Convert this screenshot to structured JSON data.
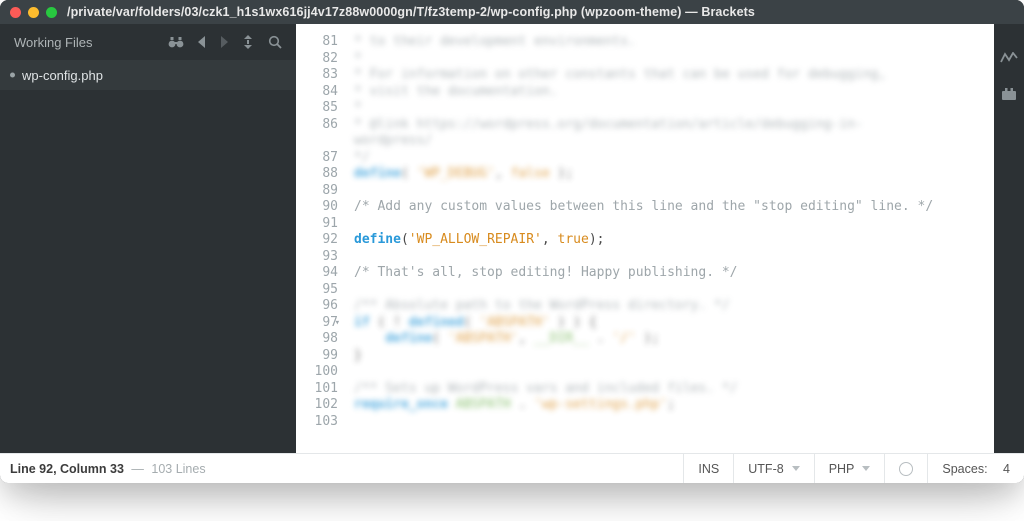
{
  "window": {
    "path": "/private/var/folders/03/czk1_h1s1wx616jj4v17z88w0000gn/T/fz3temp-2/wp-config.php (wpzoom-theme)",
    "appName": "Brackets"
  },
  "sidebar": {
    "workingFilesLabel": "Working Files",
    "files": [
      {
        "name": "wp-config.php"
      }
    ]
  },
  "editor": {
    "firstLine": 81,
    "lastLine": 103,
    "lines": {
      "81": {
        "blurred": true,
        "text": "* to their development environments."
      },
      "82": {
        "blurred": true,
        "text": "*"
      },
      "83": {
        "blurred": true,
        "text": "* For information on other constants that can be used for debugging,"
      },
      "84": {
        "blurred": true,
        "text": "* visit the documentation."
      },
      "85": {
        "blurred": true,
        "text": "*"
      },
      "86": {
        "blurred": true,
        "text": "* @link https://wordpress.org/documentation/article/debugging-in-"
      },
      "86b": {
        "blurred": true,
        "text": "wordpress/"
      },
      "87": {
        "blurred": true,
        "text": " */"
      },
      "88": {
        "blurred": true,
        "html": "<span class='c-kw'>define</span>( <span class='c-str'>'WP_DEBUG'</span>, <span class='c-bool'>false</span> );"
      },
      "89": {
        "blurred": false,
        "html": ""
      },
      "90": {
        "blurred": false,
        "html": "<span class='c-comm'>/* Add any custom values between this line and the &quot;stop editing&quot; line. */</span>"
      },
      "91": {
        "blurred": false,
        "html": ""
      },
      "92": {
        "blurred": false,
        "html": "<span class='c-kw'>define</span>(<span class='c-str'>'WP_ALLOW_REPAIR'</span>, <span class='c-bool'>true</span>);"
      },
      "93": {
        "blurred": false,
        "html": ""
      },
      "94": {
        "blurred": false,
        "html": "<span class='c-comm'>/* That's all, stop editing! Happy publishing. */</span>"
      },
      "95": {
        "blurred": false,
        "html": ""
      },
      "96": {
        "blurred": true,
        "html": "<span class='c-comm'>/** Absolute path to the WordPress directory. */</span>"
      },
      "97": {
        "blurred": true,
        "fold": true,
        "html": "<span class='c-kw'>if</span> ( ! <span class='c-kw'>defined</span>( <span class='c-str'>'ABSPATH'</span> ) ) {"
      },
      "98": {
        "blurred": true,
        "html": "&nbsp;&nbsp;&nbsp;&nbsp;<span class='c-kw'>define</span>( <span class='c-str'>'ABSPATH'</span>, <span class='c-glob'>__DIR__</span> . <span class='c-str'>'/'</span> );"
      },
      "99": {
        "blurred": true,
        "html": "}"
      },
      "100": {
        "blurred": true,
        "html": ""
      },
      "101": {
        "blurred": true,
        "html": "<span class='c-comm'>/** Sets up WordPress vars and included files. */</span>"
      },
      "102": {
        "blurred": true,
        "html": "<span class='c-kw'>require_once</span> <span class='c-glob'>ABSPATH</span> . <span class='c-str'>'wp-settings.php'</span>;"
      },
      "103": {
        "blurred": false,
        "html": ""
      }
    }
  },
  "status": {
    "cursorLine": 92,
    "cursorCol": 33,
    "totalLines": 103,
    "cursorLabel": "Line 92, Column 33",
    "linesLabel": "103 Lines",
    "insertModeLabel": "INS",
    "encodingLabel": "UTF-8",
    "languageLabel": "PHP",
    "spacesLabel": "Spaces:",
    "spacesValue": "4"
  }
}
